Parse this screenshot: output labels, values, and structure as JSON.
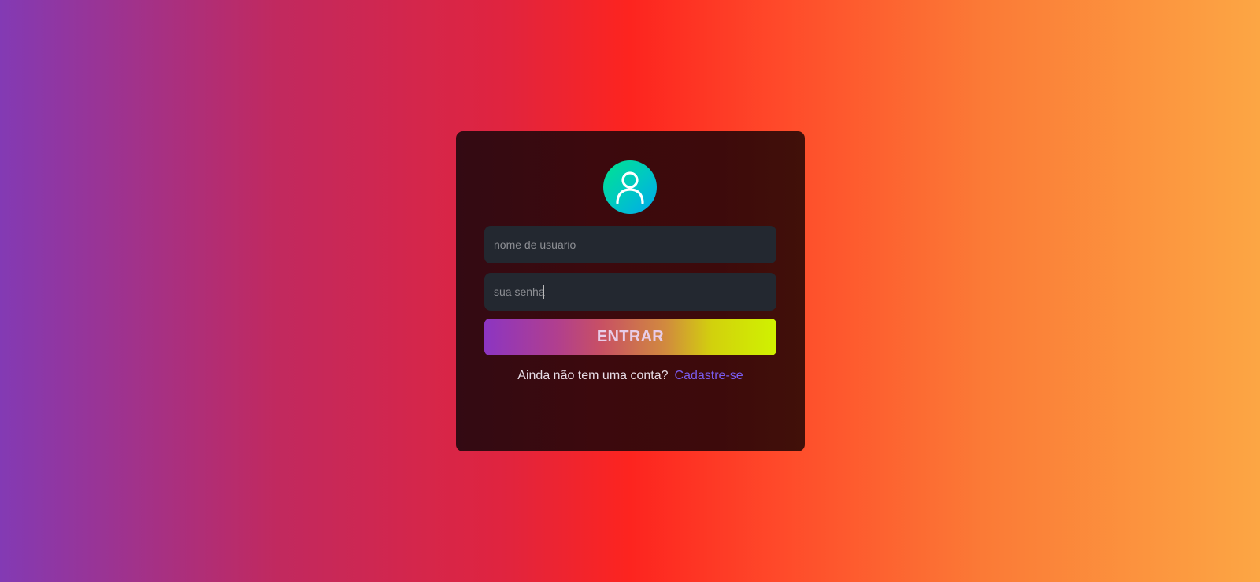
{
  "login": {
    "username_placeholder": "nome de usuario",
    "username_value": "",
    "password_placeholder": "sua senha",
    "password_value": "",
    "submit_label": "ENTRAR",
    "signup_prompt": "Ainda não tem uma conta?",
    "signup_link": "Cadastre-se"
  },
  "icons": {
    "avatar": "user-icon"
  },
  "colors": {
    "card_background": "#3c090d",
    "input_background": "#232830",
    "link": "#7a5cf0",
    "avatar_gradient": [
      "#00e38f",
      "#00a8ee"
    ],
    "button_gradient": [
      "#8c35c2",
      "#d0f200"
    ]
  }
}
